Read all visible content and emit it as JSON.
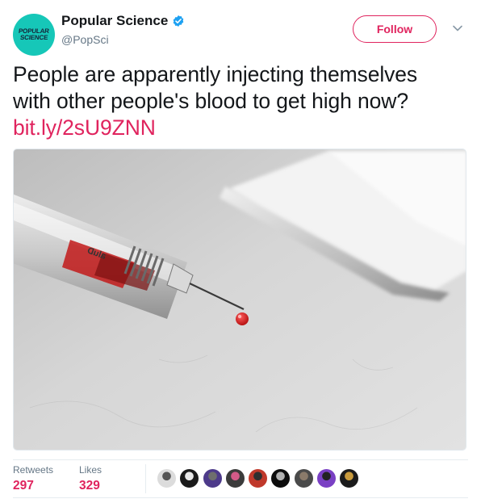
{
  "account": {
    "display_name": "Popular Science",
    "handle": "@PopSci",
    "avatar_text_line1": "POPULAR",
    "avatar_text_line2": "SCIENCE",
    "avatar_color": "#16c7b8",
    "verified": true
  },
  "follow_button": {
    "label": "Follow",
    "color": "#e0245e"
  },
  "tweet": {
    "text_line1": "People are apparently injecting themselves",
    "text_line2": "with other people's blood to get high now?",
    "link": "bit.ly/2sU9ZNN",
    "link_color": "#e0245e"
  },
  "media": {
    "icon": "syringe-with-blood-drop-photo"
  },
  "stats": {
    "retweets_label": "Retweets",
    "retweets_value": "297",
    "likes_label": "Likes",
    "likes_value": "329"
  },
  "likers": [
    {
      "name": "liker-1",
      "color": "#dcdcdc",
      "accent": "#555555"
    },
    {
      "name": "liker-2",
      "color": "#1a1a1a",
      "accent": "#e8e8e8"
    },
    {
      "name": "liker-3",
      "color": "#4d3a8a",
      "accent": "#6e6e6e"
    },
    {
      "name": "liker-4",
      "color": "#3b3b3b",
      "accent": "#d35a88"
    },
    {
      "name": "liker-5",
      "color": "#c0392b",
      "accent": "#2f2f2f"
    },
    {
      "name": "liker-6",
      "color": "#0c0c0c",
      "accent": "#b0b0b0"
    },
    {
      "name": "liker-7",
      "color": "#4a4a4a",
      "accent": "#8a7a6a"
    },
    {
      "name": "liker-8",
      "color": "#7a40c4",
      "accent": "#222222"
    },
    {
      "name": "liker-9",
      "color": "#1b1b1b",
      "accent": "#c89a3c"
    }
  ]
}
